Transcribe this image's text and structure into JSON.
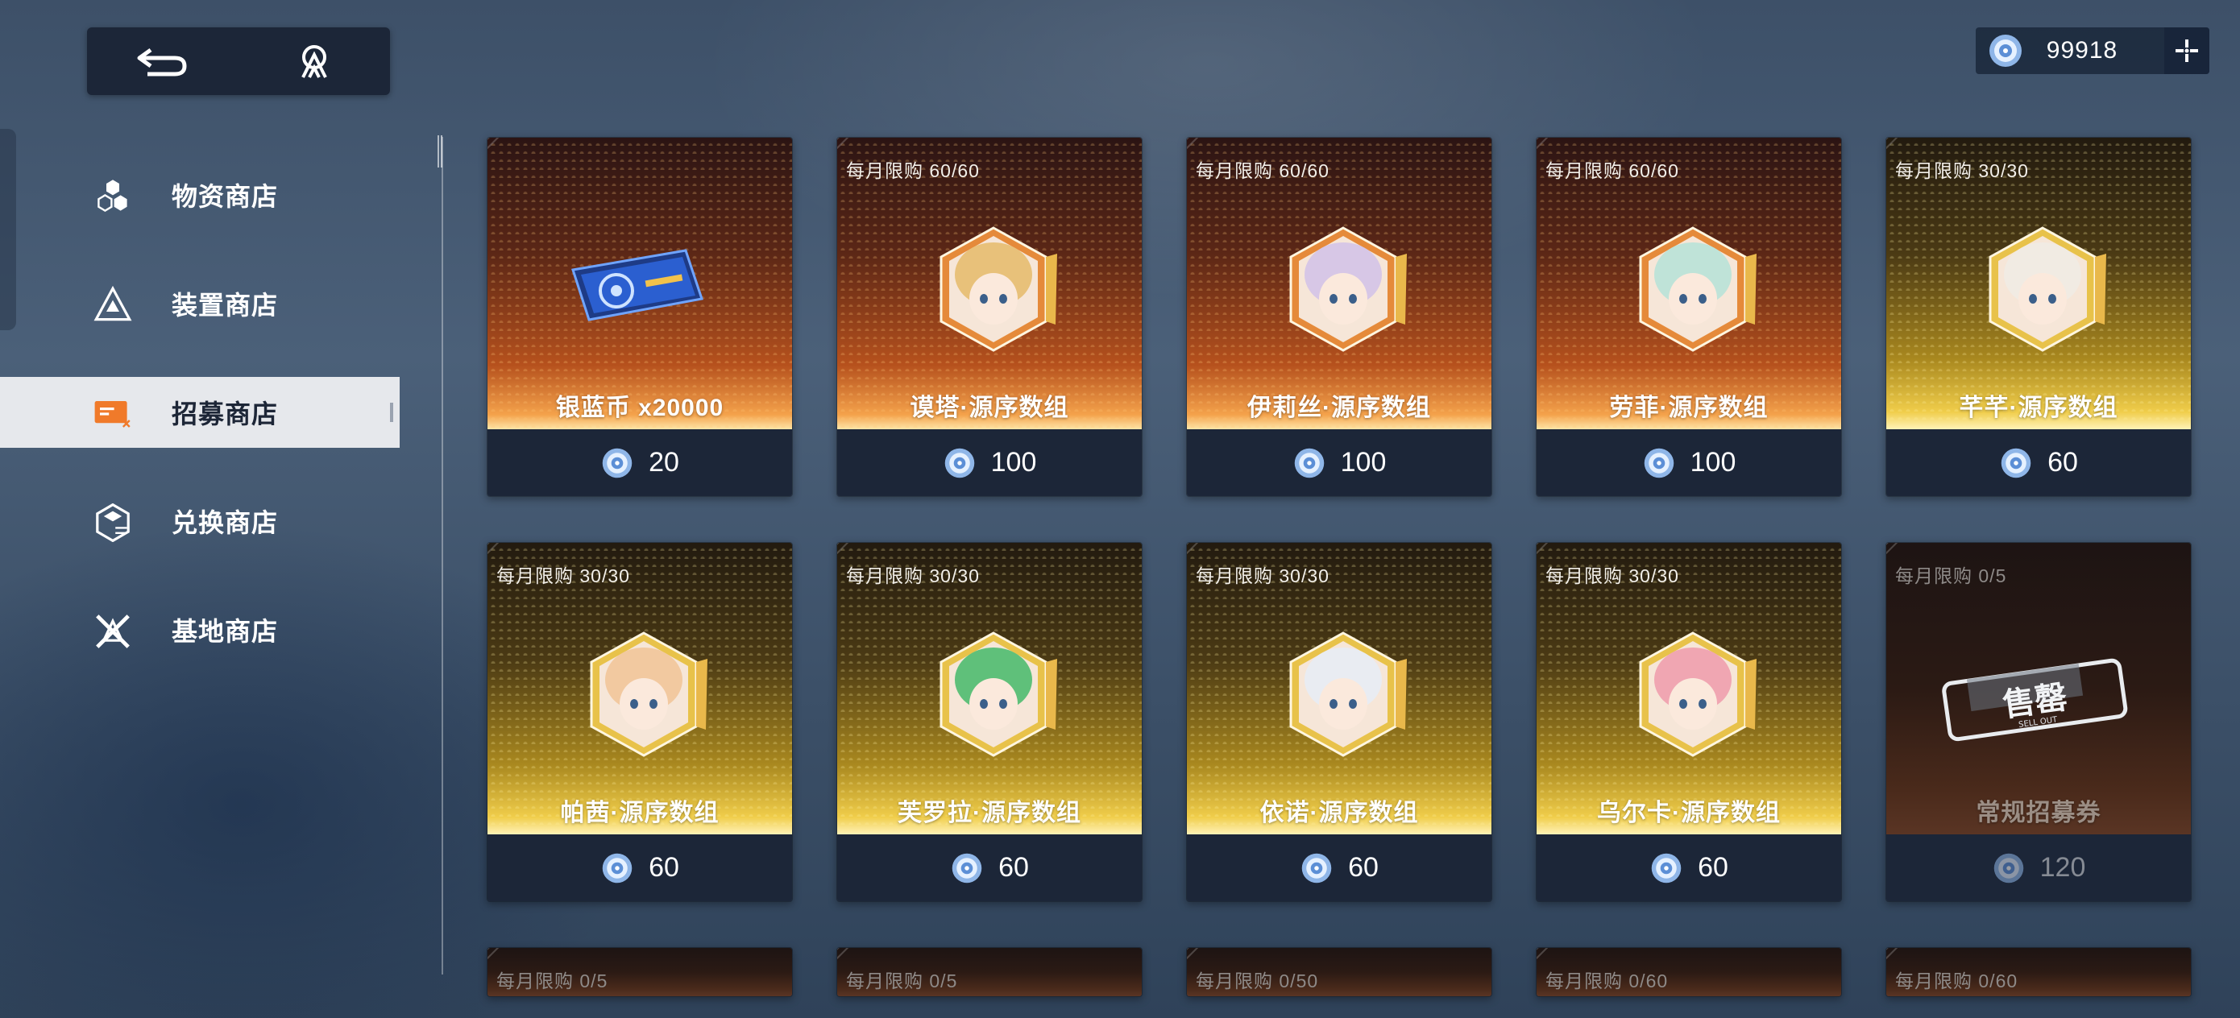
{
  "colors": {
    "panel": "#1c2638",
    "accent": "#e6e8ec",
    "orange": "#b6511d",
    "gold": "#f0cd4a"
  },
  "topnav": {
    "back_icon": "back-arrow-icon",
    "home_icon": "home-logo-icon"
  },
  "currency": {
    "icon": "crystal-coin-icon",
    "amount": "99918",
    "add_icon": "plus-icon"
  },
  "menu": [
    {
      "label": "物资商店",
      "icon": "cubes-icon",
      "active": false
    },
    {
      "label": "装置商店",
      "icon": "triangle-gear-icon",
      "active": false
    },
    {
      "label": "招募商店",
      "icon": "recruit-ticket-icon",
      "active": true
    },
    {
      "label": "兑换商店",
      "icon": "exchange-hex-icon",
      "active": false
    },
    {
      "label": "基地商店",
      "icon": "base-star-icon",
      "active": false
    }
  ],
  "cards": [
    {
      "name": "银蓝币 x20000",
      "limit": "",
      "price": "20",
      "style": "orange",
      "art": "blue-ticket"
    },
    {
      "name": "谟塔·源序数组",
      "limit": "每月限购  60/60",
      "price": "100",
      "style": "orange",
      "art": "portrait",
      "hair": "#e8c17a"
    },
    {
      "name": "伊莉丝·源序数组",
      "limit": "每月限购  60/60",
      "price": "100",
      "style": "orange",
      "art": "portrait",
      "hair": "#d7c7e6"
    },
    {
      "name": "劳菲·源序数组",
      "limit": "每月限购  60/60",
      "price": "100",
      "style": "orange",
      "art": "portrait",
      "hair": "#bfe3d8"
    },
    {
      "name": "芊芊·源序数组",
      "limit": "每月限购  30/30",
      "price": "60",
      "style": "gold",
      "art": "portrait",
      "hair": "#f1ebe3"
    },
    {
      "name": "帕茜·源序数组",
      "limit": "每月限购  30/30",
      "price": "60",
      "style": "gold",
      "art": "portrait",
      "hair": "#f2c9a0"
    },
    {
      "name": "芙罗拉·源序数组",
      "limit": "每月限购  30/30",
      "price": "60",
      "style": "gold",
      "art": "portrait",
      "hair": "#5fc07a"
    },
    {
      "name": "依诺·源序数组",
      "limit": "每月限购  30/30",
      "price": "60",
      "style": "gold",
      "art": "portrait",
      "hair": "#e9ecf2"
    },
    {
      "name": "乌尔卡·源序数组",
      "limit": "每月限购  30/30",
      "price": "60",
      "style": "gold",
      "art": "portrait",
      "hair": "#f0a6b2"
    },
    {
      "name": "常规招募券",
      "limit": "每月限购  0/5",
      "price": "120",
      "style": "dark",
      "art": "soldout",
      "stamp": "售罄",
      "stamp_sub": "SELL OUT"
    }
  ],
  "partial_cards": [
    {
      "limit": "每月限购  0/5"
    },
    {
      "limit": "每月限购  0/5"
    },
    {
      "limit": "每月限购  0/50"
    },
    {
      "limit": "每月限购  0/60"
    },
    {
      "limit": "每月限购  0/60"
    }
  ]
}
